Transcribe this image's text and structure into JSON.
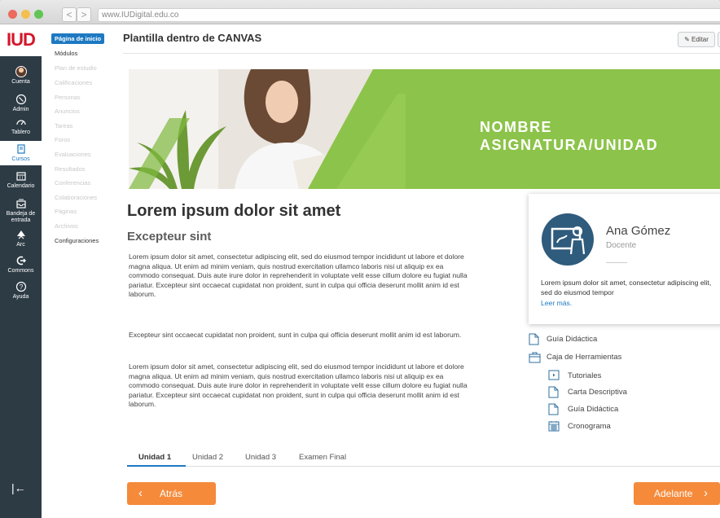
{
  "browser": {
    "url": "www.IUDigital.edu.co",
    "back": "<",
    "forward": ">"
  },
  "global_nav": {
    "logo": "IUD",
    "items": [
      {
        "label": "Cuenta",
        "icon": "avatar"
      },
      {
        "label": "Admin",
        "icon": "shield-icon"
      },
      {
        "label": "Tablero",
        "icon": "dashboard-icon"
      },
      {
        "label": "Cursos",
        "icon": "book-icon"
      },
      {
        "label": "Calendario",
        "icon": "calendar-icon"
      },
      {
        "label": "Bandeja de entrada",
        "icon": "inbox-icon"
      },
      {
        "label": "Arc",
        "icon": "arc-icon"
      },
      {
        "label": "Commons",
        "icon": "commons-icon"
      },
      {
        "label": "Ayuda",
        "icon": "help-icon"
      }
    ],
    "collapse": "|←"
  },
  "course_nav": {
    "items": [
      "Página de inicio",
      "Módulos",
      "Plan de estudio",
      "Calificaciones",
      "Personas",
      "Anuncios",
      "Tareas",
      "Foros",
      "Evaluaciones",
      "Resultados",
      "Conferencias",
      "Colaboraciones",
      "Páginas",
      "Archivos",
      "Configuraciones"
    ]
  },
  "page": {
    "title": "Plantilla dentro de CANVAS",
    "edit": "Editar",
    "banner_line1": "NOMBRE",
    "banner_line2": "ASIGNATURA/UNIDAD",
    "heading": "Lorem ipsum dolor sit amet",
    "subheading": "Excepteur sint",
    "para1": "Lorem ipsum dolor sit amet, consectetur adipiscing elit, sed do eiusmod tempor incididunt ut labore et dolore magna aliqua. Ut enim ad minim veniam, quis nostrud exercitation ullamco laboris nisi ut aliquip ex ea commodo consequat. Duis aute irure dolor in reprehenderit in voluptate velit esse cillum dolore eu fugiat nulla pariatur. Excepteur sint occaecat cupidatat non proident, sunt in culpa qui officia deserunt mollit anim id est laborum.",
    "para2": "Excepteur sint occaecat cupidatat non proident, sunt in culpa qui officia deserunt mollit anim id est laborum.",
    "para3": "Lorem ipsum dolor sit amet, consectetur adipiscing elit, sed do eiusmod tempor incididunt ut labore et dolore magna aliqua. Ut enim ad minim veniam, quis nostrud exercitation ullamco laboris nisi ut aliquip ex ea commodo consequat. Duis aute irure dolor in reprehenderit in voluptate velit esse cillum dolore eu fugiat nulla pariatur. Excepteur sint occaecat cupidatat non proident, sunt in culpa qui officia deserunt mollit anim id est laborum."
  },
  "teacher": {
    "name": "Ana Gómez",
    "role": "Docente",
    "desc": "Lorem ipsum dolor sit amet, consectetur adipiscing elit, sed do eiusmod tempor",
    "more": "Leer más."
  },
  "resources": {
    "guide": "Guía Didáctica",
    "toolbox": "Caja de Herramientas",
    "tutorials": "Tutoriales",
    "letter": "Carta Descriptiva",
    "guide2": "Guía Didáctica",
    "schedule": "Cronograma"
  },
  "tabs": [
    "Unidad 1",
    "Unidad 2",
    "Unidad 3",
    "Examen Final"
  ],
  "nav": {
    "prev": "Atrás",
    "next": "Adelante"
  },
  "colors": {
    "canvas_nav": "#2d3b45",
    "accent_blue": "#1d79c2",
    "banner_green": "#8cc34a",
    "button_orange": "#f58a3a",
    "logo_red": "#d4172b",
    "teacher_icon": "#2f5b7c"
  }
}
